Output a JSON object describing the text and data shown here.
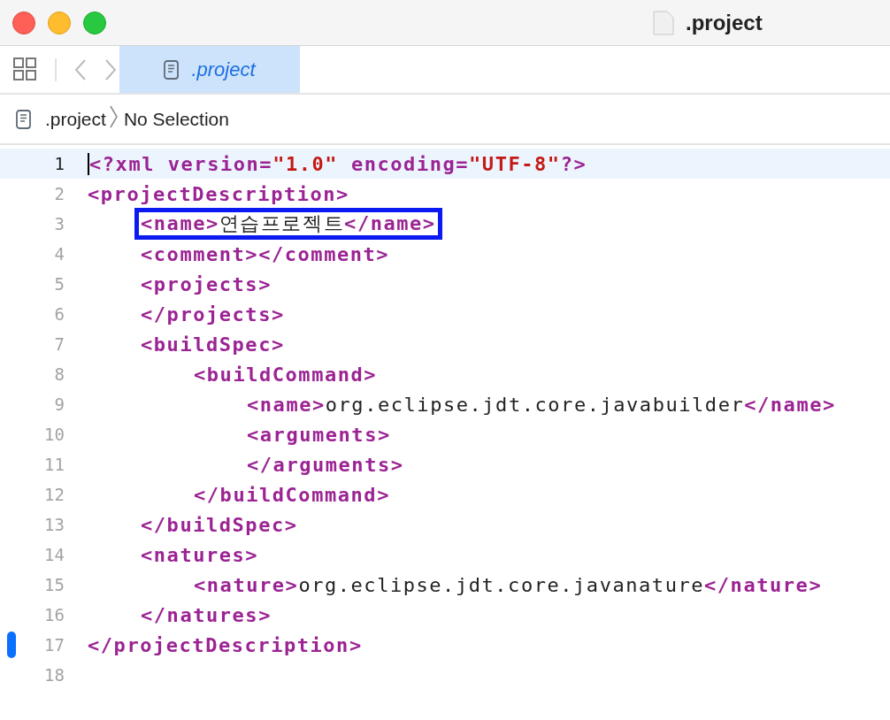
{
  "window": {
    "title": ".project"
  },
  "toolbar": {
    "tabs": [
      {
        "label": ".project",
        "selected": true
      }
    ]
  },
  "breadcrumb": {
    "items": [
      ".project",
      "No Selection"
    ]
  },
  "editor": {
    "lines": [
      {
        "number": "1",
        "current": true,
        "changed": false,
        "boxed": false,
        "tokens": [
          {
            "kind": "tag",
            "text": "<?xml version="
          },
          {
            "kind": "string",
            "text": "\"1.0\""
          },
          {
            "kind": "tag",
            "text": " encoding="
          },
          {
            "kind": "string",
            "text": "\"UTF-8\""
          },
          {
            "kind": "tag",
            "text": "?>"
          }
        ]
      },
      {
        "number": "2",
        "current": false,
        "changed": false,
        "boxed": false,
        "tokens": [
          {
            "kind": "tag",
            "text": "<projectDescription>"
          }
        ]
      },
      {
        "number": "3",
        "current": false,
        "changed": false,
        "boxed": true,
        "tokens": [
          {
            "kind": "tag",
            "text": "    <name>"
          },
          {
            "kind": "text",
            "text": "연습프로젝트"
          },
          {
            "kind": "tag",
            "text": "</name>"
          }
        ]
      },
      {
        "number": "4",
        "current": false,
        "changed": false,
        "boxed": false,
        "tokens": [
          {
            "kind": "tag",
            "text": "    <comment></comment>"
          }
        ]
      },
      {
        "number": "5",
        "current": false,
        "changed": false,
        "boxed": false,
        "tokens": [
          {
            "kind": "tag",
            "text": "    <projects>"
          }
        ]
      },
      {
        "number": "6",
        "current": false,
        "changed": false,
        "boxed": false,
        "tokens": [
          {
            "kind": "tag",
            "text": "    </projects>"
          }
        ]
      },
      {
        "number": "7",
        "current": false,
        "changed": false,
        "boxed": false,
        "tokens": [
          {
            "kind": "tag",
            "text": "    <buildSpec>"
          }
        ]
      },
      {
        "number": "8",
        "current": false,
        "changed": false,
        "boxed": false,
        "tokens": [
          {
            "kind": "tag",
            "text": "        <buildCommand>"
          }
        ]
      },
      {
        "number": "9",
        "current": false,
        "changed": false,
        "boxed": false,
        "tokens": [
          {
            "kind": "tag",
            "text": "            <name>"
          },
          {
            "kind": "text",
            "text": "org.eclipse.jdt.core.javabuilder"
          },
          {
            "kind": "tag",
            "text": "</name>"
          }
        ]
      },
      {
        "number": "10",
        "current": false,
        "changed": false,
        "boxed": false,
        "tokens": [
          {
            "kind": "tag",
            "text": "            <arguments>"
          }
        ]
      },
      {
        "number": "11",
        "current": false,
        "changed": false,
        "boxed": false,
        "tokens": [
          {
            "kind": "tag",
            "text": "            </arguments>"
          }
        ]
      },
      {
        "number": "12",
        "current": false,
        "changed": false,
        "boxed": false,
        "tokens": [
          {
            "kind": "tag",
            "text": "        </buildCommand>"
          }
        ]
      },
      {
        "number": "13",
        "current": false,
        "changed": false,
        "boxed": false,
        "tokens": [
          {
            "kind": "tag",
            "text": "    </buildSpec>"
          }
        ]
      },
      {
        "number": "14",
        "current": false,
        "changed": false,
        "boxed": false,
        "tokens": [
          {
            "kind": "tag",
            "text": "    <natures>"
          }
        ]
      },
      {
        "number": "15",
        "current": false,
        "changed": false,
        "boxed": false,
        "tokens": [
          {
            "kind": "tag",
            "text": "        <nature>"
          },
          {
            "kind": "text",
            "text": "org.eclipse.jdt.core.javanature"
          },
          {
            "kind": "tag",
            "text": "</nature>"
          }
        ]
      },
      {
        "number": "16",
        "current": false,
        "changed": false,
        "boxed": false,
        "tokens": [
          {
            "kind": "tag",
            "text": "    </natures>"
          }
        ]
      },
      {
        "number": "17",
        "current": false,
        "changed": true,
        "boxed": false,
        "tokens": [
          {
            "kind": "tag",
            "text": "</projectDescription>"
          }
        ]
      },
      {
        "number": "18",
        "current": false,
        "changed": false,
        "boxed": false
      }
    ]
  }
}
